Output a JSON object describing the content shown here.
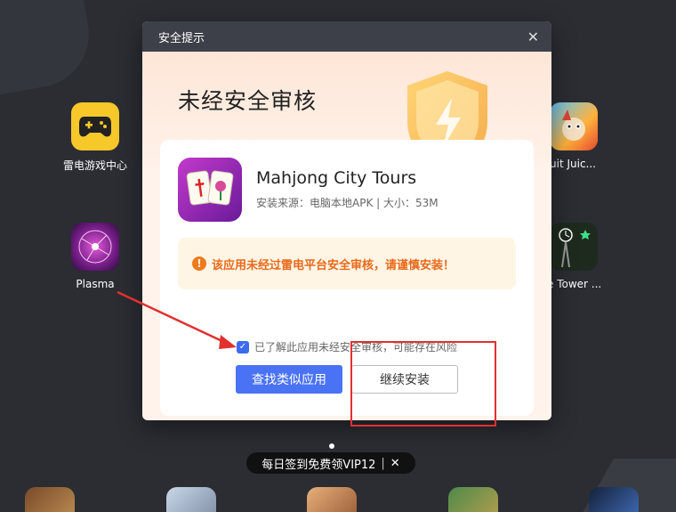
{
  "desktop": {
    "icons": [
      {
        "label": "雷电游戏中心"
      },
      {
        "label": "Plasma"
      },
      {
        "label": "uit Juic..."
      },
      {
        "label": "e Tower ..."
      }
    ]
  },
  "promo": {
    "text": "每日签到免费领VIP12",
    "separator": "|",
    "close": "✕"
  },
  "dialog": {
    "title": "安全提示",
    "close_glyph": "✕",
    "hero_title": "未经安全审核",
    "app": {
      "name": "Mahjong City Tours",
      "meta": "安装来源：电脑本地APK | 大小：53M"
    },
    "warning": {
      "icon": "!",
      "text": "该应用未经过雷电平台安全审核，请谨慎安装！"
    },
    "consent": {
      "checked": true,
      "check_glyph": "✓",
      "label": "已了解此应用未经安全审核，可能存在风险"
    },
    "buttons": {
      "find_similar": "查找类似应用",
      "continue_install": "继续安装"
    }
  },
  "colors": {
    "primary_button": "#4a72f5",
    "warning_text": "#e8691a",
    "annotation": "#e23030"
  }
}
